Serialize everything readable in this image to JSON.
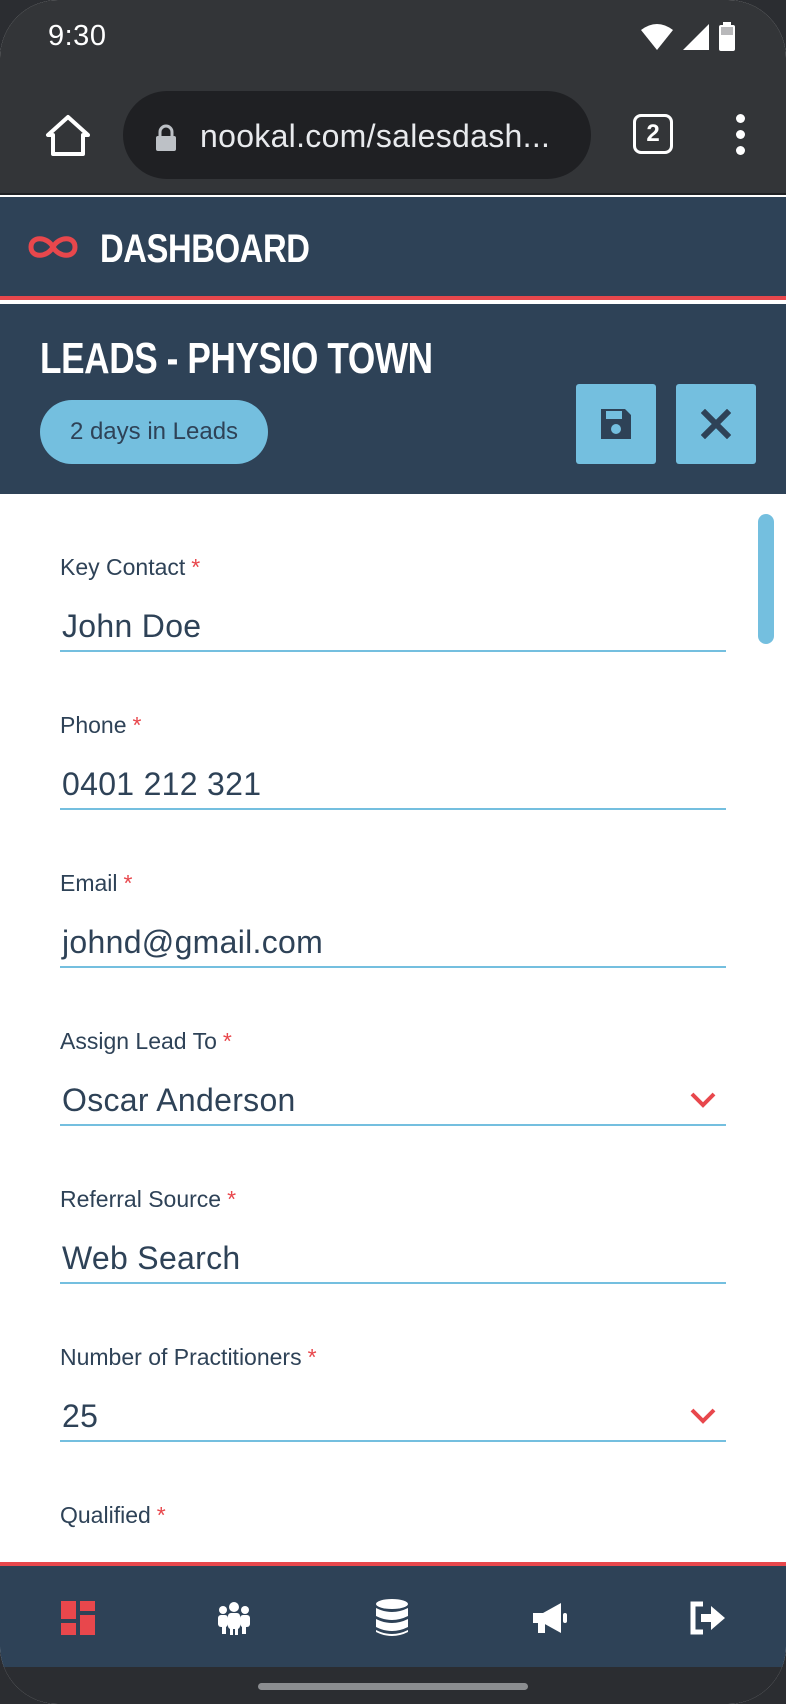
{
  "status_bar": {
    "time": "9:30"
  },
  "browser": {
    "url": "nookal.com/salesdash...",
    "tab_count": "2"
  },
  "app": {
    "title": "DASHBOARD"
  },
  "lead": {
    "title": "LEADS - PHYSIO TOWN",
    "days_badge": "2 days in Leads"
  },
  "form": {
    "required_mark": "*",
    "fields": [
      {
        "label": "Key Contact",
        "value": "John Doe"
      },
      {
        "label": "Phone",
        "value": "0401 212 321"
      },
      {
        "label": "Email",
        "value": "johnd@gmail.com"
      },
      {
        "label": "Assign Lead To",
        "value": "Oscar Anderson"
      },
      {
        "label": "Referral Source",
        "value": "Web Search"
      },
      {
        "label": "Number of Practitioners",
        "value": "25"
      },
      {
        "label": "Qualified",
        "value": ""
      }
    ]
  },
  "colors": {
    "accent": "#e8474c",
    "brand_navy": "#2e4257",
    "light_blue": "#74bfdf"
  },
  "icons": {
    "header": [
      "infinity-logo-icon",
      "save-icon",
      "close-icon"
    ],
    "nav": [
      "dashboard-icon",
      "users-icon",
      "database-icon",
      "megaphone-icon",
      "logout-icon"
    ]
  }
}
